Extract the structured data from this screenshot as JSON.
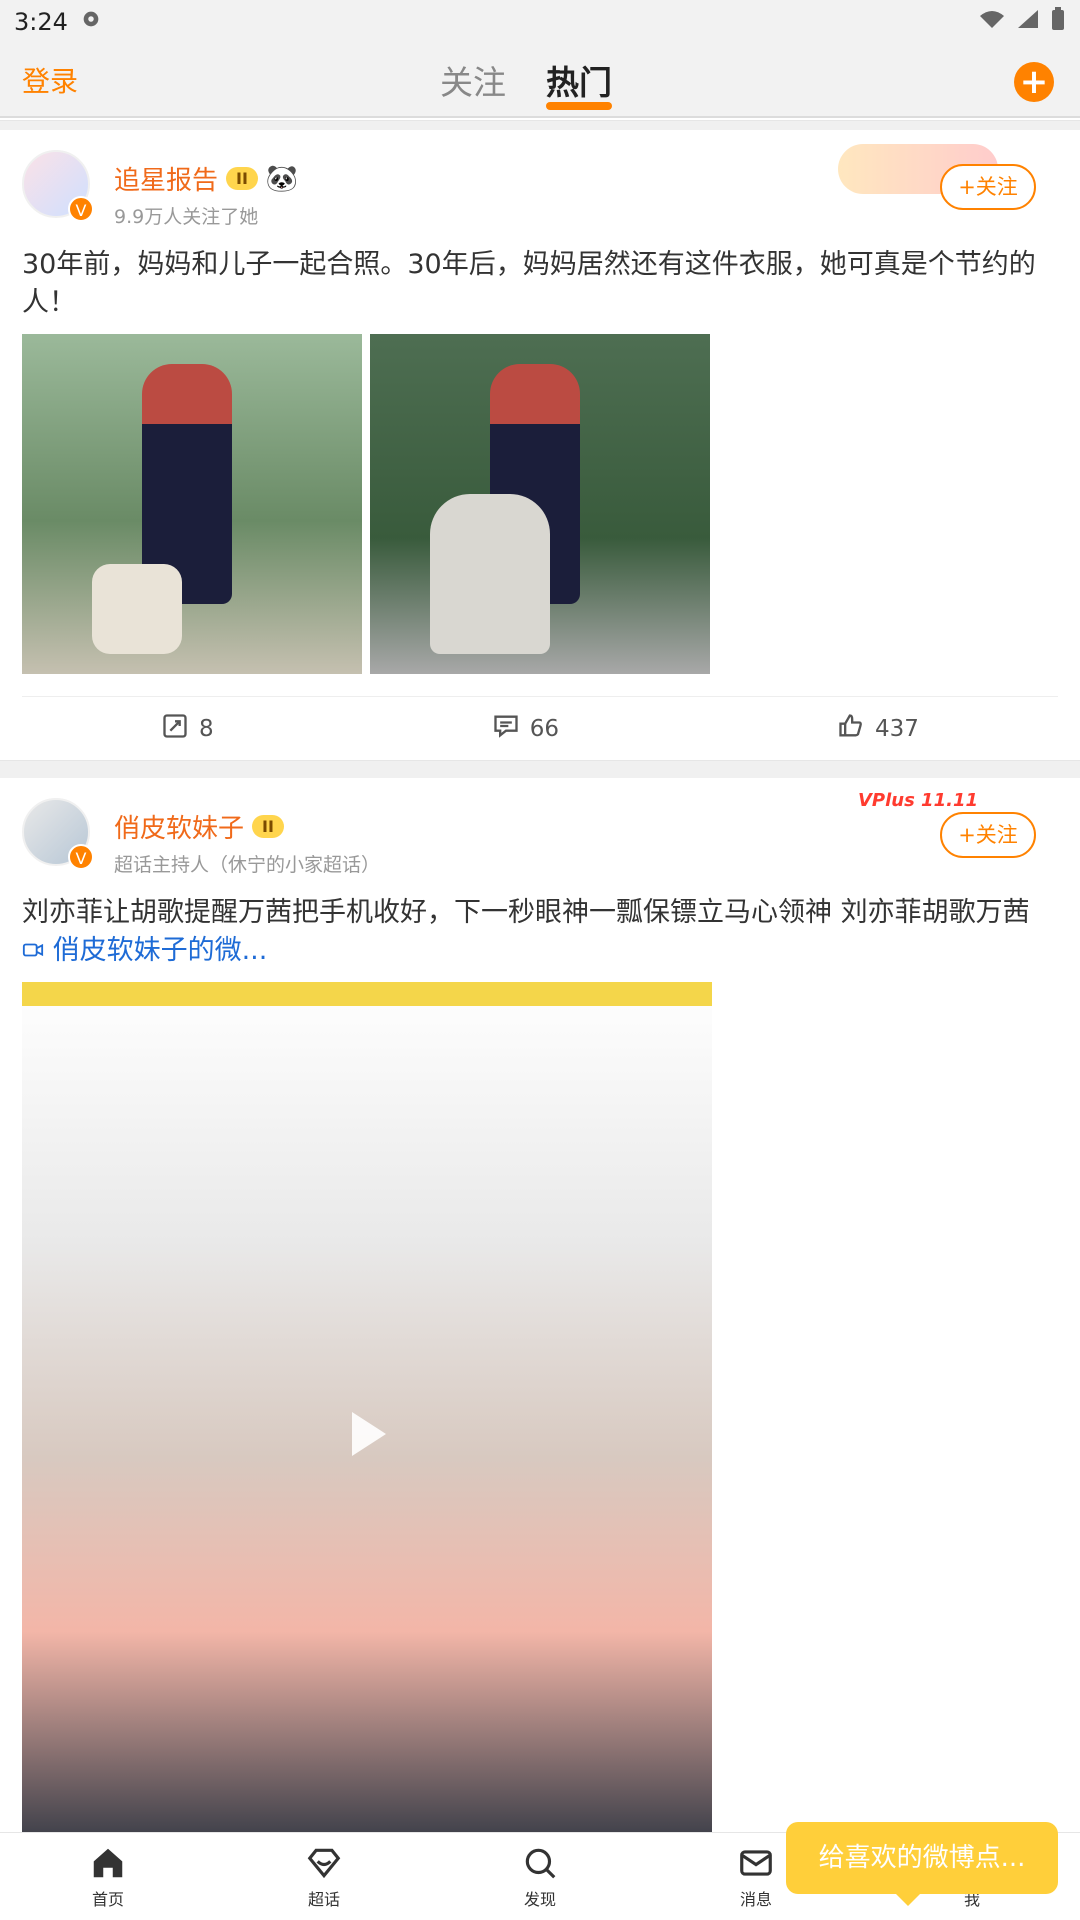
{
  "status": {
    "time": "3:24"
  },
  "topnav": {
    "login": "登录",
    "tabs": [
      {
        "label": "关注"
      },
      {
        "label": "热门"
      }
    ],
    "compose": "+"
  },
  "posts": [
    {
      "author": "追星报告",
      "badge": "II",
      "subtitle": "9.9万人关注了她",
      "follow": "+关注",
      "text": "30年前，妈妈和儿子一起合照。30年后，妈妈居然还有这件衣服，她可真是个节约的人！",
      "actions": {
        "repost": "8",
        "comment": "66",
        "like": "437"
      }
    },
    {
      "author": "俏皮软妹子",
      "badge": "II",
      "subtitle": "超话主持人（休宁的小家超话）",
      "follow": "+关注",
      "text_main": "刘亦菲让胡歌提醒万茜把手机收好，下一秒眼神一瓢保镖立马心领神 刘亦菲胡歌万茜 ",
      "text_link": "俏皮软妹子的微...",
      "decor_text": "VPlus 11.11"
    }
  ],
  "bottomnav": [
    {
      "label": "首页"
    },
    {
      "label": "超话"
    },
    {
      "label": "发现"
    },
    {
      "label": "消息"
    },
    {
      "label": "我"
    }
  ],
  "tooltip": "给喜欢的微博点..."
}
